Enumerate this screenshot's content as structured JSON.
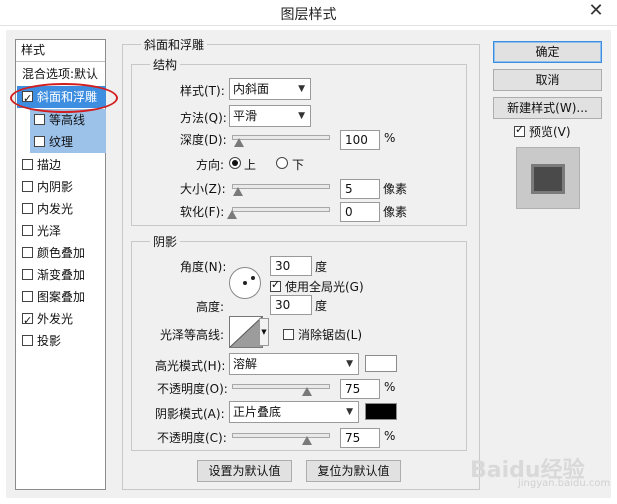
{
  "window": {
    "title": "图层样式",
    "close_glyph": "✕"
  },
  "nav": {
    "header": "样式",
    "items": [
      {
        "label": "混合选项:默认",
        "checkbox": false,
        "checked": false
      },
      {
        "label": "斜面和浮雕",
        "checkbox": true,
        "checked": true,
        "selected": true
      },
      {
        "label": "等高线",
        "checkbox": true,
        "checked": false,
        "sub": true
      },
      {
        "label": "纹理",
        "checkbox": true,
        "checked": false,
        "sub": true
      },
      {
        "label": "描边",
        "checkbox": true,
        "checked": false
      },
      {
        "label": "内阴影",
        "checkbox": true,
        "checked": false
      },
      {
        "label": "内发光",
        "checkbox": true,
        "checked": false
      },
      {
        "label": "光泽",
        "checkbox": true,
        "checked": false
      },
      {
        "label": "颜色叠加",
        "checkbox": true,
        "checked": false
      },
      {
        "label": "渐变叠加",
        "checkbox": true,
        "checked": false
      },
      {
        "label": "图案叠加",
        "checkbox": true,
        "checked": false
      },
      {
        "label": "外发光",
        "checkbox": true,
        "checked": true
      },
      {
        "label": "投影",
        "checkbox": true,
        "checked": false
      }
    ]
  },
  "bevel": {
    "group_title": "斜面和浮雕",
    "structure": {
      "title": "结构",
      "style_label": "样式(T):",
      "style_value": "内斜面",
      "method_label": "方法(Q):",
      "method_value": "平滑",
      "depth_label": "深度(D):",
      "depth_value": "100",
      "depth_unit": "%",
      "depth_fraction": 0.1,
      "direction_label": "方向:",
      "dir_up": "上",
      "dir_down": "下",
      "dir_selected": "上",
      "size_label": "大小(Z):",
      "size_value": "5",
      "size_unit": "像素",
      "size_fraction": 0.02,
      "soften_label": "软化(F):",
      "soften_value": "0",
      "soften_unit": "像素",
      "soften_fraction": 0.0
    },
    "shading": {
      "title": "阴影",
      "angle_label": "角度(N):",
      "angle_value": "30",
      "angle_unit": "度",
      "global_light_label": "使用全局光(G)",
      "global_light_checked": true,
      "altitude_label": "高度:",
      "altitude_value": "30",
      "altitude_unit": "度",
      "gloss_contour_label": "光泽等高线:",
      "antialias_label": "消除锯齿(L)",
      "antialias_checked": false,
      "highlight_mode_label": "高光模式(H):",
      "highlight_mode_value": "溶解",
      "highlight_color": "#ffffff",
      "highlight_opacity_label": "不透明度(O):",
      "highlight_opacity_value": "75",
      "highlight_opacity_unit": "%",
      "highlight_opacity_fraction": 0.75,
      "shadow_mode_label": "阴影模式(A):",
      "shadow_mode_value": "正片叠底",
      "shadow_color": "#000000",
      "shadow_opacity_label": "不透明度(C):",
      "shadow_opacity_value": "75",
      "shadow_opacity_unit": "%",
      "shadow_opacity_fraction": 0.75
    },
    "set_default_label": "设置为默认值",
    "reset_default_label": "复位为默认值"
  },
  "right": {
    "ok_label": "确定",
    "cancel_label": "取消",
    "new_style_label": "新建样式(W)...",
    "preview_label": "预览(V)",
    "preview_checked": true
  },
  "watermark": {
    "text": "Baidu经验",
    "sub": "jingyan.baidu.com"
  },
  "colors": {
    "selection": "#3d8ee0",
    "sub_selection": "#9cc2ea",
    "annotation": "#d11f1f"
  }
}
